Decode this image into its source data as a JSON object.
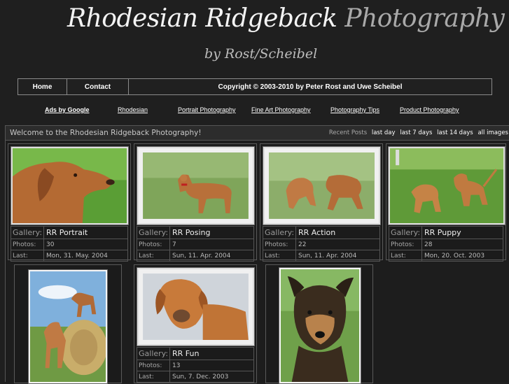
{
  "header": {
    "title_main": "Rhodesian Ridgeback",
    "title_accent": "Photography",
    "subtitle": "by Rost/Scheibel"
  },
  "nav": {
    "home": "Home",
    "contact": "Contact",
    "copyright": "Copyright © 2003-2010 by Peter Rost and Uwe Scheibel"
  },
  "ads": {
    "label": "Ads by Google",
    "links": [
      "Rhodesian",
      "Portrait Photography",
      "Fine Art Photography",
      "Photography Tips",
      "Product Photography"
    ]
  },
  "main": {
    "welcome": "Welcome to the Rhodesian Ridgeback Photography!",
    "recent_label": "Recent Posts",
    "recent_links": [
      "last day",
      "last 7 days",
      "last 14 days",
      "all images"
    ]
  },
  "labels": {
    "gallery": "Gallery:",
    "photos": "Photos:",
    "last": "Last:"
  },
  "galleries": [
    {
      "name": "RR Portrait",
      "photos": "30",
      "last": "Mon, 31. May. 2004"
    },
    {
      "name": "RR Posing",
      "photos": "7",
      "last": "Sun, 11. Apr. 2004"
    },
    {
      "name": "RR Action",
      "photos": "22",
      "last": "Sun, 11. Apr. 2004"
    },
    {
      "name": "RR Puppy",
      "photos": "28",
      "last": "Mon, 20. Oct. 2003"
    },
    {
      "name": "RR Fun",
      "photos": "13",
      "last": "Sun, 7. Dec. 2003"
    }
  ],
  "colors": {
    "background": "#1f1f1f",
    "border": "#8a8a8a",
    "grass": "#5f9a3a",
    "dog": "#b86a35"
  }
}
